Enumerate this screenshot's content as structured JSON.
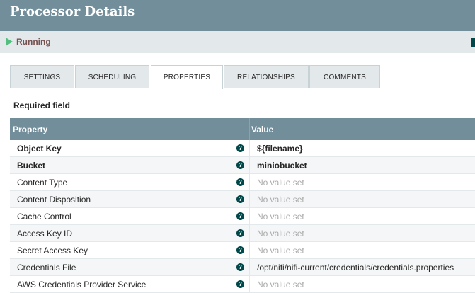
{
  "header": {
    "title": "Processor Details"
  },
  "status": {
    "icon": "play-icon",
    "label": "Running",
    "color": "#52bf7e"
  },
  "tabs": [
    {
      "label": "SETTINGS",
      "active": false
    },
    {
      "label": "SCHEDULING",
      "active": false
    },
    {
      "label": "PROPERTIES",
      "active": true
    },
    {
      "label": "RELATIONSHIPS",
      "active": false
    },
    {
      "label": "COMMENTS",
      "active": false
    }
  ],
  "required_field": "Required field",
  "table": {
    "columns": {
      "property": "Property",
      "value": "Value"
    },
    "rows": [
      {
        "name": "Object Key",
        "value": "${filename}",
        "required": true,
        "empty": false
      },
      {
        "name": "Bucket",
        "value": "miniobucket",
        "required": true,
        "empty": false
      },
      {
        "name": "Content Type",
        "value": "No value set",
        "required": false,
        "empty": true
      },
      {
        "name": "Content Disposition",
        "value": "No value set",
        "required": false,
        "empty": true
      },
      {
        "name": "Cache Control",
        "value": "No value set",
        "required": false,
        "empty": true
      },
      {
        "name": "Access Key ID",
        "value": "No value set",
        "required": false,
        "empty": true
      },
      {
        "name": "Secret Access Key",
        "value": "No value set",
        "required": false,
        "empty": true
      },
      {
        "name": "Credentials File",
        "value": "/opt/nifi/nifi-current/credentials/credentials.properties",
        "required": false,
        "empty": false
      },
      {
        "name": "AWS Credentials Provider Service",
        "value": "No value set",
        "required": false,
        "empty": true
      }
    ]
  },
  "colors": {
    "header": "#728e9b",
    "accent": "#004849"
  }
}
